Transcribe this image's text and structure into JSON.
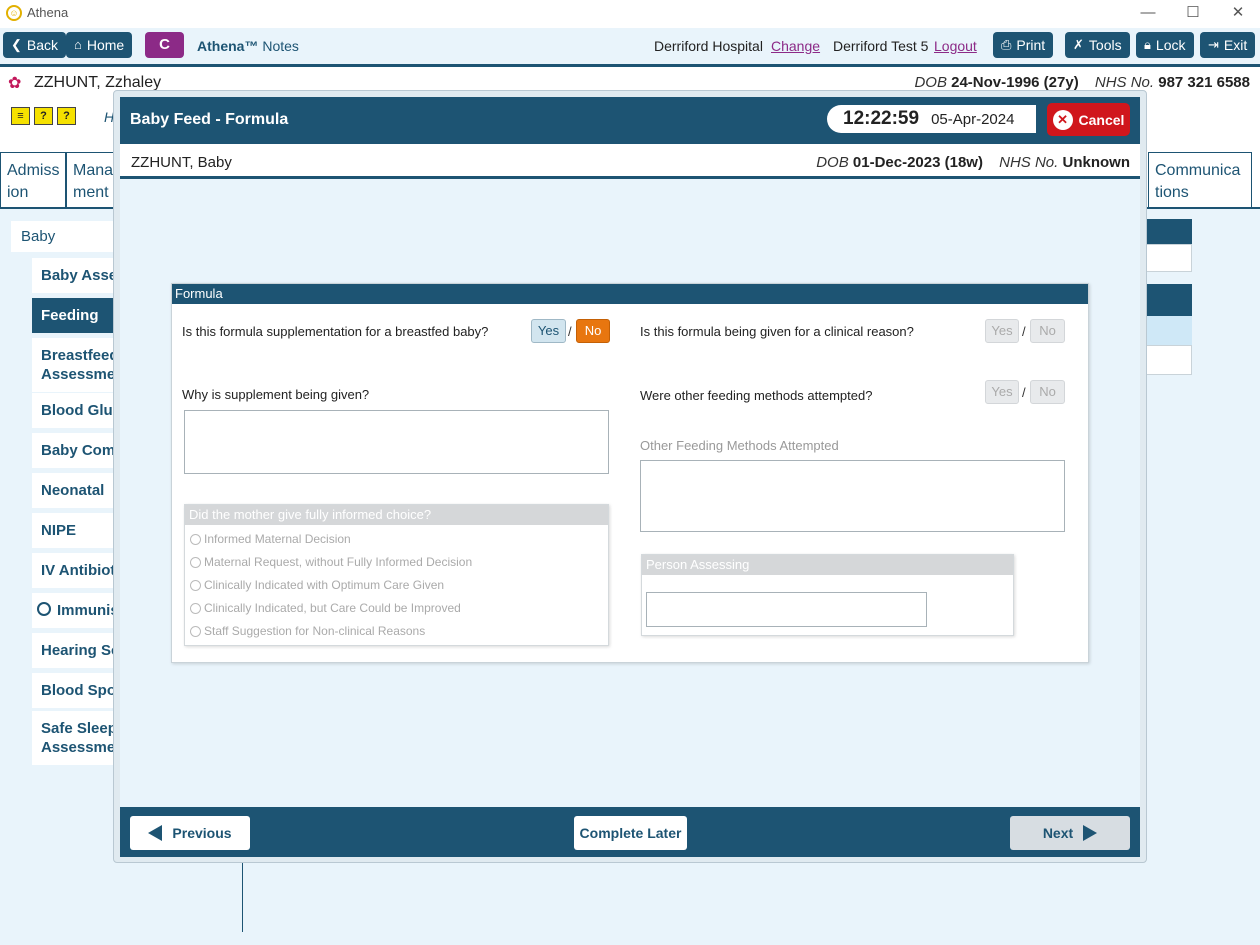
{
  "window": {
    "title": "Athena"
  },
  "navbar": {
    "back": "Back",
    "home": "Home",
    "c_button": "C",
    "brand_name": "Athena™",
    "brand_suffix": "Notes",
    "hospital": "Derriford Hospital",
    "change": "Change",
    "user": "Derriford Test 5",
    "logout": "Logout",
    "print": "Print",
    "tools": "Tools",
    "lock": "Lock",
    "exit": "Exit"
  },
  "patient": {
    "name": "ZZHUNT, Zzhaley",
    "dob_label": "DOB",
    "dob": "24-Nov-1996 (27y)",
    "nhs_label": "NHS No.",
    "nhs": "987 321 6588"
  },
  "background": {
    "h_letter": "H",
    "tabs": [
      "Admiss\nion",
      "Mana\nment",
      "Communica\ntions"
    ],
    "sidebar_header": "Baby",
    "sidebar": [
      "Baby Asses",
      "Feeding",
      "Breastfeedi\nAssessment",
      "Blood Gluc",
      "Baby Comn",
      "Neonatal",
      "NIPE",
      "IV Antibiot",
      "Immunis",
      "Hearing Sc",
      "Blood Spot",
      "Safe Sleepi\nAssessment"
    ]
  },
  "modal": {
    "title": "Baby Feed - Formula",
    "time": "12:22:59",
    "date": "05-Apr-2024",
    "cancel": "Cancel",
    "baby_name": "ZZHUNT, Baby",
    "dob_label": "DOB",
    "dob": "01-Dec-2023 (18w)",
    "nhs_label": "NHS No.",
    "nhs": "Unknown",
    "footer": {
      "previous": "Previous",
      "complete_later": "Complete Later",
      "next": "Next"
    }
  },
  "form": {
    "section": "Formula",
    "q_breastfed": "Is this formula supplementation for a breastfed baby?",
    "q_clinical": "Is this formula being given for a clinical reason?",
    "q_why": "Why is supplement being given?",
    "q_other_methods": "Were other feeding methods attempted?",
    "other_methods_label": "Other Feeding Methods Attempted",
    "yes": "Yes",
    "no": "No",
    "slash": "/",
    "breastfed_answer": "No",
    "informed_choice": {
      "title": "Did the mother give fully informed choice?",
      "options": [
        "Informed Maternal Decision",
        "Maternal Request, without Fully Informed Decision",
        "Clinically Indicated with Optimum Care Given",
        "Clinically Indicated, but Care Could be Improved",
        "Staff Suggestion for Non-clinical Reasons"
      ]
    },
    "person_assessing": "Person Assessing"
  },
  "colors": {
    "primary": "#1d5473",
    "accent_no": "#e8760f",
    "cancel": "#d0161c",
    "c_button": "#8c2a87"
  }
}
